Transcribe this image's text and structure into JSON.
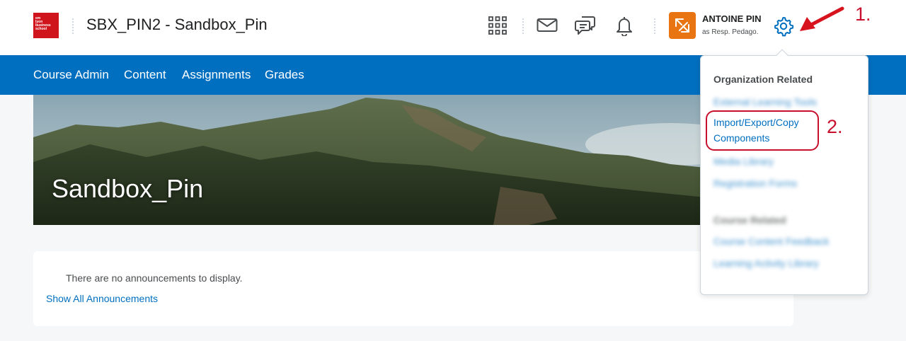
{
  "header": {
    "logo_lines": [
      "em",
      "lyon",
      "business",
      "school"
    ],
    "course_title": "SBX_PIN2 - Sandbox_Pin",
    "icons": [
      "apps-grid-icon",
      "mail-icon",
      "chat-icon",
      "bell-icon",
      "role-switch-icon",
      "gear-icon"
    ],
    "user": {
      "name": "ANTOINE PIN",
      "role": "as Resp. Pedago."
    }
  },
  "nav": {
    "items": [
      "Course Admin",
      "Content",
      "Assignments",
      "Grades"
    ]
  },
  "banner": {
    "title": "Sandbox_Pin"
  },
  "announcements": {
    "empty_text": "There are no announcements to display.",
    "show_all_link": "Show All Announcements"
  },
  "dropdown": {
    "org_heading": "Organization Related",
    "org_items": [
      "External Learning Tools",
      "Import/Export/Copy Components",
      "Media Library",
      "Registration Forms"
    ],
    "course_heading": "Course Related",
    "course_items": [
      "Course Content Feedback",
      "Learning Activity Library"
    ]
  },
  "annotations": {
    "step1": "1.",
    "step2": "2."
  },
  "colors": {
    "nav_blue": "#006fbf",
    "link_blue": "#006fbf",
    "annotation_red": "#c8102e",
    "avatar_orange": "#e87511",
    "logo_red": "#d0141b"
  }
}
